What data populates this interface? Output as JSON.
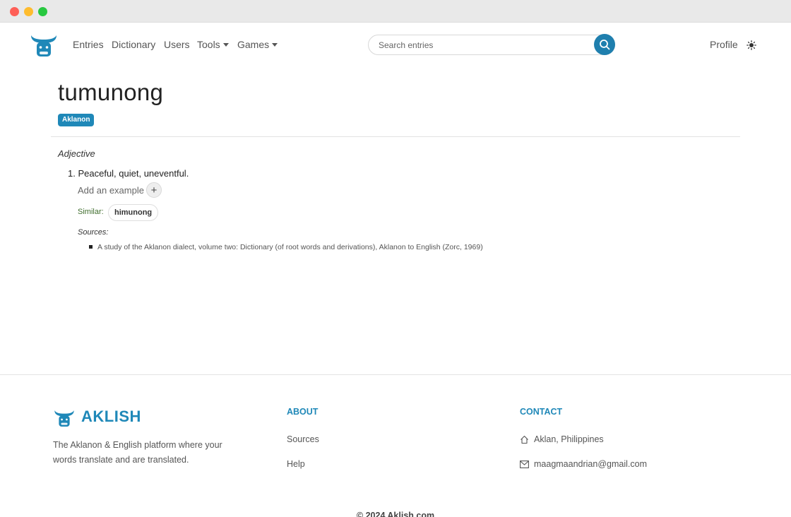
{
  "brand": {
    "name": "AKLISH",
    "logo_icon": "carabao-logo-icon",
    "accent": "#1f88b8"
  },
  "nav": {
    "links": {
      "entries": "Entries",
      "dictionary": "Dictionary",
      "users": "Users",
      "tools": "Tools",
      "games": "Games"
    },
    "search_placeholder": "Search entries",
    "profile": "Profile",
    "theme_icon": "sun-icon"
  },
  "entry": {
    "word": "tumunong",
    "language": "Aklanon",
    "part_of_speech": "Adjective",
    "definition_number": "1.",
    "definition": "Peaceful, quiet, uneventful.",
    "add_example": "Add an example",
    "similar_label": "Similar:",
    "similar_word": "himunong",
    "sources_label": "Sources:",
    "source": "A study of the Aklanon dialect, volume two: Dictionary (of root words and derivations), Aklanon to English (Zorc, 1969)"
  },
  "footer": {
    "tagline": "The Aklanon & English platform where your words translate and are translated.",
    "about_heading": "ABOUT",
    "about_links": {
      "sources": "Sources",
      "help": "Help"
    },
    "contact_heading": "CONTACT",
    "location": "Aklan, Philippines",
    "email": "maagmaandrian@gmail.com",
    "copyright": "© 2024 Aklish.com"
  }
}
